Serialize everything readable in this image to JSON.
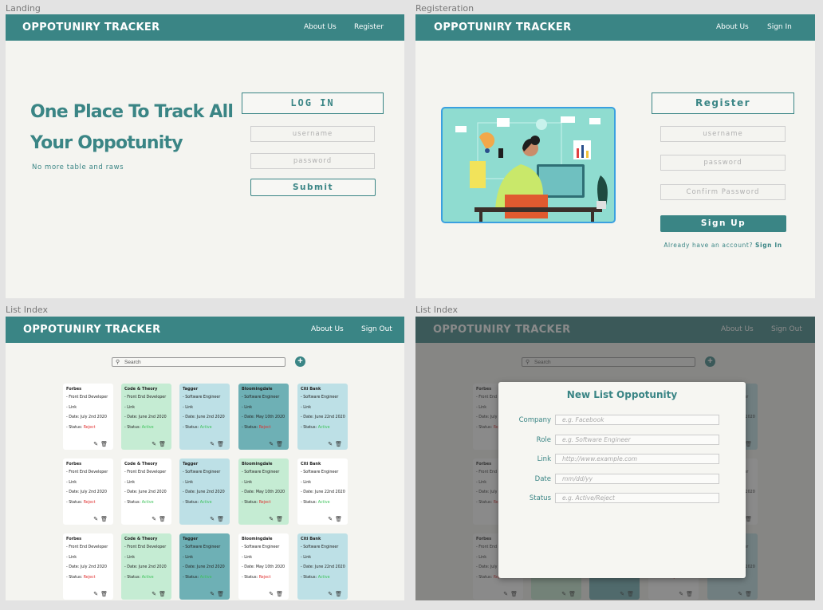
{
  "frames": {
    "landing": "Landing",
    "register": "Registeration",
    "list_index": "List Index",
    "list_index_modal": "List Index"
  },
  "brand": "OPPOTUNIRY TRACKER",
  "nav": {
    "about": "About Us",
    "register": "Register",
    "sign_in": "Sign In",
    "sign_out": "Sign Out"
  },
  "landing": {
    "headline_1": "One Place To Track All",
    "headline_2": "Your Oppotunity",
    "tagline": "No more table and raws",
    "login_header": "LOG IN",
    "username_placeholder": "username",
    "password_placeholder": "password",
    "submit_label": "Submit"
  },
  "register": {
    "header": "Register",
    "username_placeholder": "username",
    "password_placeholder": "password",
    "confirm_placeholder": "Confirm Password",
    "signup_label": "Sign Up",
    "have_account": "Already have an account?",
    "sign_in_link": "Sign In"
  },
  "list": {
    "search_placeholder": "Search",
    "add_icon": "+",
    "status_prefix": "- Status: "
  },
  "cards": [
    {
      "company": "Forbes",
      "role": "- Front End Developer",
      "link": "- Link",
      "date": "- Date: July 2nd 2020",
      "status": "Reject",
      "bg": "#ffffff"
    },
    {
      "company": "Code & Theory",
      "role": "- Front End Developer",
      "link": "- Link",
      "date": "- Date: June 2nd 2020",
      "status": "Active",
      "bg": "#c5ecd3"
    },
    {
      "company": "Tagger",
      "role": "- Software Engineer",
      "link": "- Link",
      "date": "- Date: June 2nd 2020",
      "status": "Active",
      "bg": "#bde0e6"
    },
    {
      "company": "Bloomingdale",
      "role": "- Software Engineer",
      "link": "- Link",
      "date": "- Date: May 10th 2020",
      "status": "Reject",
      "bg": "#6eb0b5"
    },
    {
      "company": "Citi Bank",
      "role": "- Software Engineer",
      "link": "- Link",
      "date": "- Date: June 22nd 2020",
      "status": "Active",
      "bg": "#bde0e6"
    },
    {
      "company": "Forbes",
      "role": "- Front End Developer",
      "link": "- Link",
      "date": "- Date: July 2nd 2020",
      "status": "Reject",
      "bg": "#ffffff"
    },
    {
      "company": "Code & Theory",
      "role": "- Front End Developer",
      "link": "- Link",
      "date": "- Date: June 2nd 2020",
      "status": "Active",
      "bg": "#ffffff"
    },
    {
      "company": "Tagger",
      "role": "- Software Engineer",
      "link": "- Link",
      "date": "- Date: June 2nd 2020",
      "status": "Active",
      "bg": "#bde0e6"
    },
    {
      "company": "Bloomingdale",
      "role": "- Software Engineer",
      "link": "- Link",
      "date": "- Date: May 10th 2020",
      "status": "Reject",
      "bg": "#c5ecd3"
    },
    {
      "company": "Citi Bank",
      "role": "- Software Engineer",
      "link": "- Link",
      "date": "- Date: June 22nd 2020",
      "status": "Active",
      "bg": "#ffffff"
    },
    {
      "company": "Forbes",
      "role": "- Front End Developer",
      "link": "- Link",
      "date": "- Date: July 2nd 2020",
      "status": "Reject",
      "bg": "#ffffff"
    },
    {
      "company": "Code & Theory",
      "role": "- Front End Developer",
      "link": "- Link",
      "date": "- Date: June 2nd 2020",
      "status": "Active",
      "bg": "#c5ecd3"
    },
    {
      "company": "Tagger",
      "role": "- Software Engineer",
      "link": "- Link",
      "date": "- Date: June 2nd 2020",
      "status": "Active",
      "bg": "#6eb0b5"
    },
    {
      "company": "Bloomingdale",
      "role": "- Software Engineer",
      "link": "- Link",
      "date": "- Date: May 10th 2020",
      "status": "Reject",
      "bg": "#ffffff"
    },
    {
      "company": "Citi Bank",
      "role": "- Software Engineer",
      "link": "- Link",
      "date": "- Date: June 22nd 2020",
      "status": "Active",
      "bg": "#bde0e6"
    }
  ],
  "modal": {
    "title": "New List Oppotunity",
    "fields": [
      {
        "label": "Company",
        "placeholder": "e.g.  Facebook"
      },
      {
        "label": "Role",
        "placeholder": "e.g. Software Engineer"
      },
      {
        "label": "Link",
        "placeholder": "http://www.example.com"
      },
      {
        "label": "Date",
        "placeholder": "mm/dd/yy"
      },
      {
        "label": "Status",
        "placeholder": "e.g. Active/Reject"
      }
    ]
  },
  "colors": {
    "teal": "#3a8585",
    "active": "#3cc25a",
    "reject": "#e03030",
    "illustration_border": "#3aa0e0"
  },
  "icons": {
    "edit": "edit-icon",
    "delete": "trash-icon",
    "search": "search-icon",
    "add": "plus-icon"
  }
}
